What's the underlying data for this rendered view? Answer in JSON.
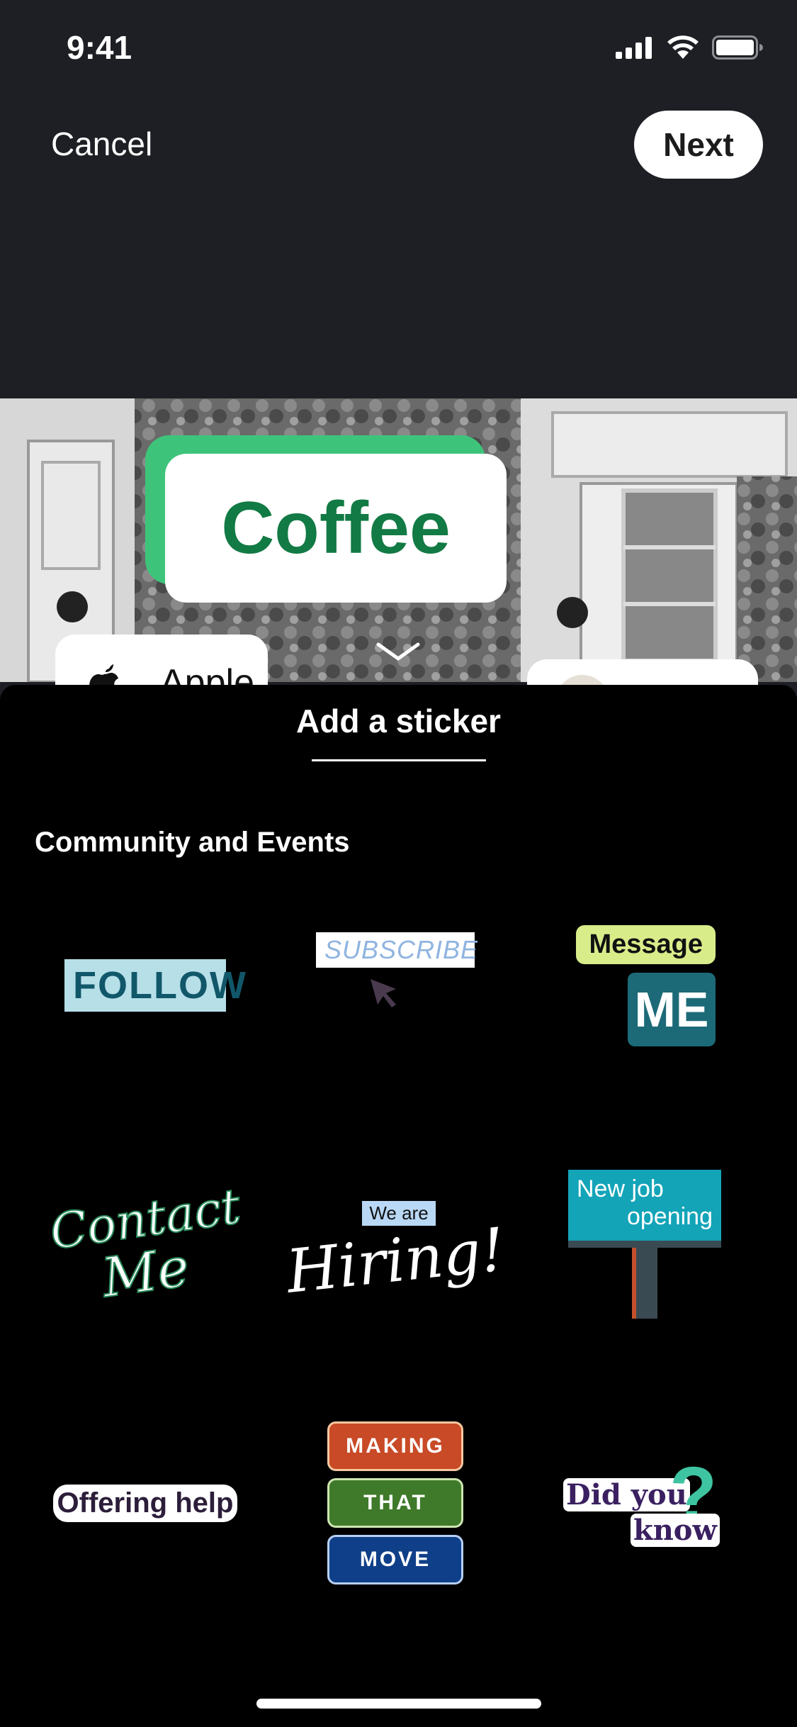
{
  "status_bar": {
    "time": "9:41"
  },
  "top_bar": {
    "cancel_label": "Cancel",
    "next_label": "Next"
  },
  "photo_stickers": {
    "coffee": "Coffee",
    "apple": "Apple"
  },
  "sheet": {
    "title": "Add a sticker",
    "section_title": "Community and Events"
  },
  "stickers": {
    "follow": "FOLLOW",
    "subscribe": "SUBSCRIBE",
    "message_top": "Message",
    "message_bottom": "ME",
    "contact_line1": "Contact",
    "contact_line2": "Me",
    "hiring_top": "We are",
    "hiring_main": "Hiring!",
    "job_line1": "New job",
    "job_line2": "opening",
    "offering": "Offering help",
    "moves_1": "MAKING",
    "moves_2": "THAT",
    "moves_3": "MOVE",
    "didyou_1": "Did you",
    "didyou_2": "know"
  },
  "colors": {
    "background": "#1d1f24",
    "sheet": "#000000",
    "coffee_green": "#127a44",
    "coffee_shadow": "#3ec47a"
  }
}
